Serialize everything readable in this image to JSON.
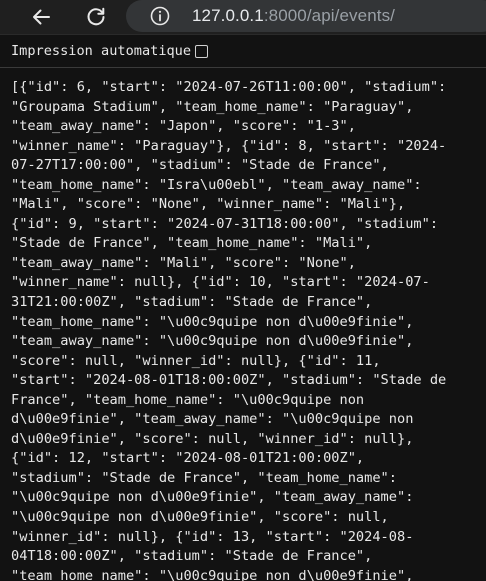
{
  "browser": {
    "back_icon": "arrow-left-icon",
    "reload_icon": "reload-icon",
    "info_icon": "info-icon",
    "url_host": "127.0.0.1",
    "url_path": ":8000/api/events/"
  },
  "viewer": {
    "pretty_print_label": "Impression automatique",
    "pretty_print_checked": false,
    "json_lines": [
      "[{\"id\": 6, \"start\": \"2024-07-26T11:00:00\", \"stadium\":",
      "\"Groupama Stadium\", \"team_home_name\": \"Paraguay\",",
      "\"team_away_name\": \"Japon\", \"score\": \"1-3\",",
      "\"winner_name\": \"Paraguay\"}, {\"id\": 8, \"start\": \"2024-",
      "07-27T17:00:00\", \"stadium\": \"Stade de France\",",
      "\"team_home_name\": \"Isra\\u00ebl\", \"team_away_name\":",
      "\"Mali\", \"score\": \"None\", \"winner_name\": \"Mali\"},",
      "{\"id\": 9, \"start\": \"2024-07-31T18:00:00\", \"stadium\":",
      "\"Stade de France\", \"team_home_name\": \"Mali\",",
      "\"team_away_name\": \"Mali\", \"score\": \"None\",",
      "\"winner_name\": null}, {\"id\": 10, \"start\": \"2024-07-",
      "31T21:00:00Z\", \"stadium\": \"Stade de France\",",
      "\"team_home_name\": \"\\u00c9quipe non d\\u00e9finie\",",
      "\"team_away_name\": \"\\u00c9quipe non d\\u00e9finie\",",
      "\"score\": null, \"winner_id\": null}, {\"id\": 11,",
      "\"start\": \"2024-08-01T18:00:00Z\", \"stadium\": \"Stade de",
      "France\", \"team_home_name\": \"\\u00c9quipe non",
      "d\\u00e9finie\", \"team_away_name\": \"\\u00c9quipe non",
      "d\\u00e9finie\", \"score\": null, \"winner_id\": null},",
      "{\"id\": 12, \"start\": \"2024-08-01T21:00:00Z\",",
      "\"stadium\": \"Stade de France\", \"team_home_name\":",
      "\"\\u00c9quipe non d\\u00e9finie\", \"team_away_name\":",
      "\"\\u00c9quipe non d\\u00e9finie\", \"score\": null,",
      "\"winner_id\": null}, {\"id\": 13, \"start\": \"2024-08-",
      "04T18:00:00Z\", \"stadium\": \"Stade de France\",",
      "\"team_home_name\": \"\\u00c9quipe non d\\u00e9finie\",",
      "\"team_away_name\": \"\\u00c9quipe non d\\u00e9finie\","
    ]
  }
}
